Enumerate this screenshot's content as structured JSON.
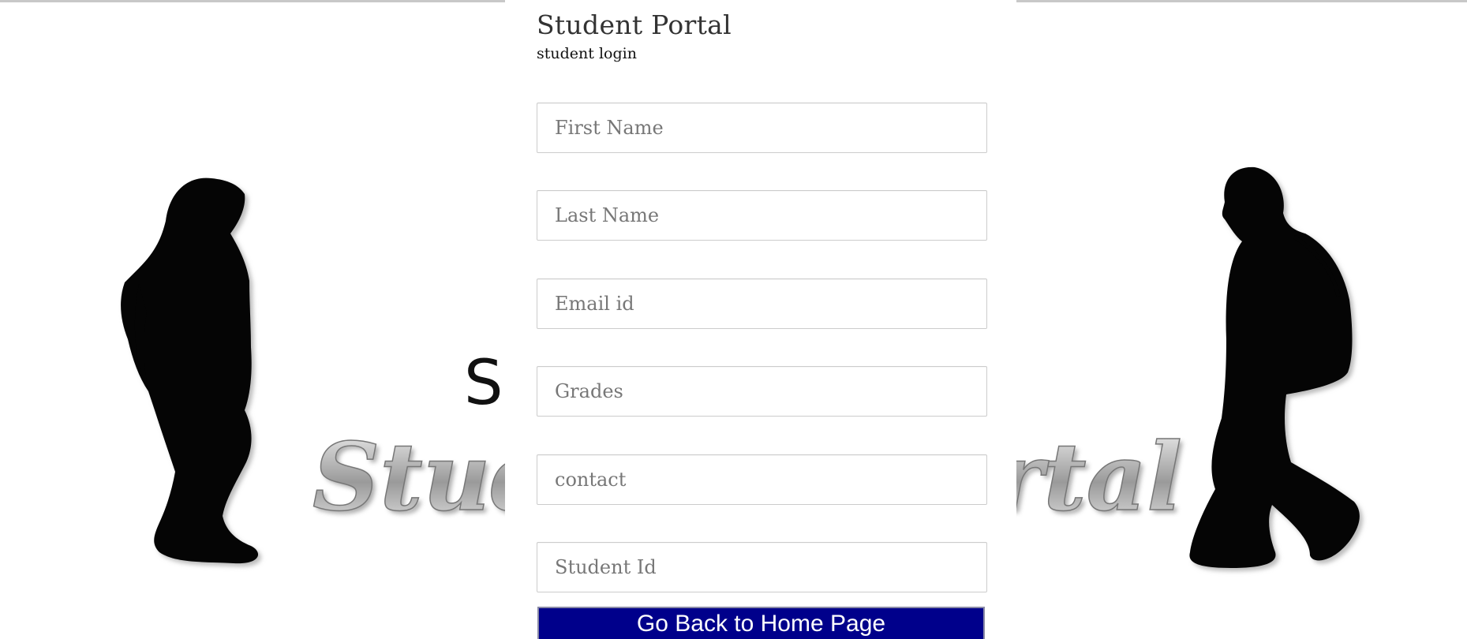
{
  "header": {
    "title": "Student Portal",
    "subtitle": "student login"
  },
  "form": {
    "fields": [
      {
        "name": "first-name-input",
        "placeholder": "First Name",
        "value": ""
      },
      {
        "name": "last-name-input",
        "placeholder": "Last Name",
        "value": ""
      },
      {
        "name": "email-input",
        "placeholder": "Email id",
        "value": ""
      },
      {
        "name": "grades-input",
        "placeholder": "Grades",
        "value": ""
      },
      {
        "name": "contact-input",
        "placeholder": "contact",
        "value": ""
      },
      {
        "name": "student-id-input",
        "placeholder": "Student Id",
        "value": ""
      }
    ],
    "back_button_label": "Go Back to Home Page"
  },
  "background": {
    "logo_text": "Student Portal",
    "icons": [
      "girl-silhouette-icon",
      "boy-silhouette-icon"
    ]
  },
  "colors": {
    "button_bg": "#00008b",
    "button_text": "#ffffff",
    "field_border": "#cccccc",
    "title_text": "#333333"
  }
}
